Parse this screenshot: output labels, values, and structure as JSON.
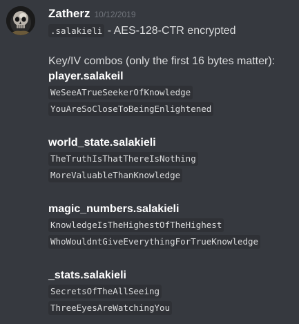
{
  "message": {
    "author": "Zatherz",
    "timestamp": "10/12/2019",
    "first_line_code": ".salakieli",
    "first_line_text": " - AES-128-CTR encrypted",
    "intro": "Key/IV combos (only the first 16 bytes matter):",
    "groups": [
      {
        "title": "player.salakeil",
        "key": "WeSeeATrueSeekerOfKnowledge",
        "iv": "YouAreSoCloseToBeingEnlightened"
      },
      {
        "title": "world_state.salakieli",
        "key": "TheTruthIsThatThereIsNothing",
        "iv": "MoreValuableThanKnowledge"
      },
      {
        "title": "magic_numbers.salakieli",
        "key": "KnowledgeIsTheHighestOfTheHighest",
        "iv": "WhoWouldntGiveEverythingForTrueKnowledge"
      },
      {
        "title": "_stats.salakieli",
        "key": "SecretsOfTheAllSeeing",
        "iv": "ThreeEyesAreWatchingYou"
      }
    ]
  },
  "icons": {
    "avatar": "skull-avatar-icon"
  },
  "colors": {
    "background": "#36393f",
    "username": "#ffffff",
    "timestamp": "#72767d",
    "text": "#dcddde",
    "code_background": "#2f3136"
  }
}
